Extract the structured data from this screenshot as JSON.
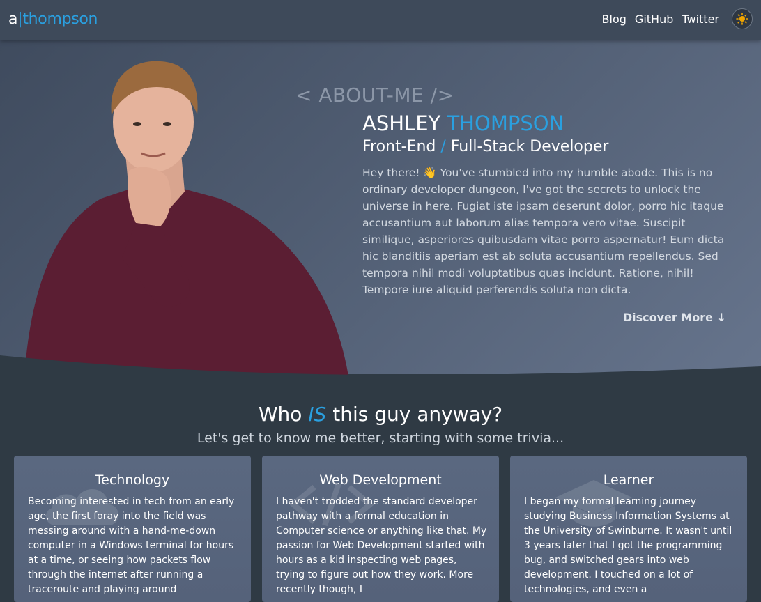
{
  "brand": {
    "a": "a",
    "separator": "|",
    "name": "thompson"
  },
  "nav": {
    "blog": "Blog",
    "github": "GitHub",
    "twitter": "Twitter"
  },
  "theme_toggle": {
    "icon": "sun-icon",
    "color": "#f0a500"
  },
  "hero": {
    "tag": "< ABOUT-ME />",
    "first_name": "ASHLEY",
    "last_name": "THOMPSON",
    "role_front": "Front-End",
    "role_slash": "/",
    "role_rest": "Full-Stack Developer",
    "bio": "Hey there! 👋 You've stumbled into my humble abode. This is no ordinary developer dungeon, I've got the secrets to unlock the universe in here. Fugiat iste ipsam deserunt dolor, porro hic itaque accusantium aut laborum alias tempora vero vitae. Suscipit similique, asperiores quibusdam vitae porro aspernatur! Eum dicta hic blanditiis aperiam est ab soluta accusantium repellendus. Sed tempora nihil modi voluptatibus quas incidunt. Ratione, nihil! Tempore iure aliquid perferendis soluta non dicta.",
    "discover": "Discover More ↓"
  },
  "section": {
    "title_before": "Who",
    "title_is": "IS",
    "title_after": "this guy anyway?",
    "subtitle": "Let's get to know me better, starting with some trivia..."
  },
  "cards": [
    {
      "title": "Technology",
      "text": "Becoming interested in tech from an early age, the first foray into the field was messing around with a hand-me-down computer in a Windows terminal for hours at a time, or seeing how packets flow through the internet after running a traceroute and playing around"
    },
    {
      "title": "Web Development",
      "text": "I haven't trodded the standard developer pathway with a formal education in Computer science or anything like that. My passion for Web Development started with hours as a kid inspecting web pages, trying to figure out how they work. More recently though, I"
    },
    {
      "title": "Learner",
      "text": "I began my formal learning journey studying Business Information Systems at the University of Swinburne. It wasn't until 3 years later that I got the programming bug, and switched gears into web development. I touched on a lot of technologies, and even a"
    }
  ],
  "colors": {
    "accent": "#2aa0e0",
    "hero_bg": "#4e5b70",
    "page_bg": "#2f3a44",
    "card_bg": "#5a6880"
  }
}
